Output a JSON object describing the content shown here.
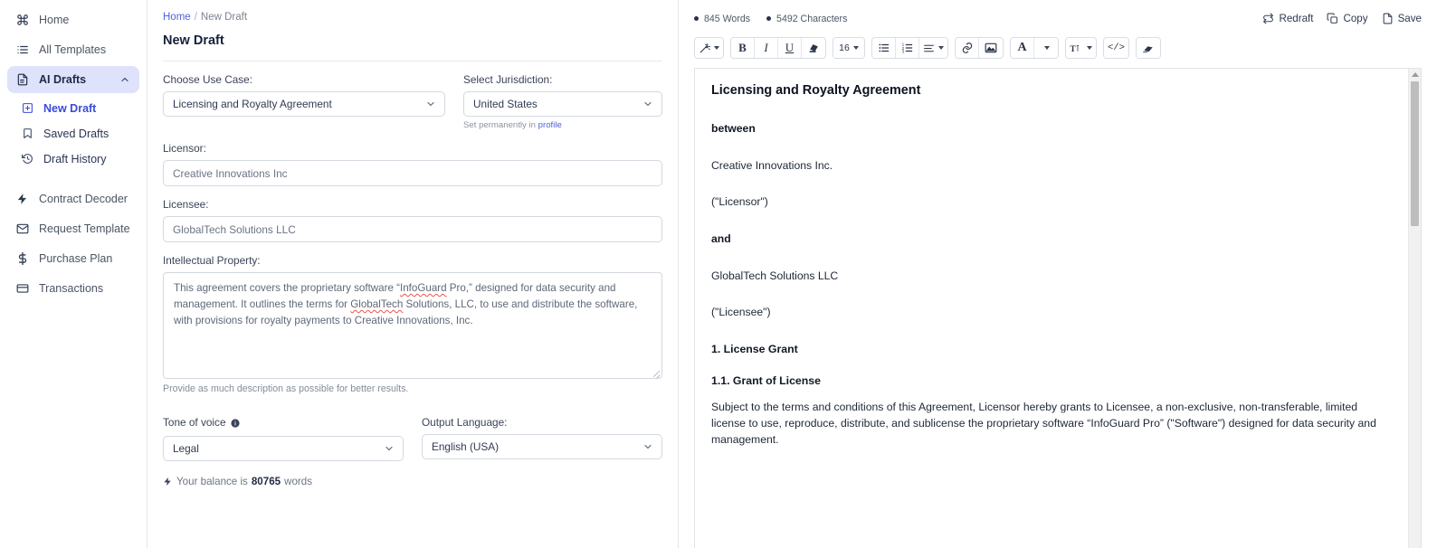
{
  "sidebar": {
    "items": [
      {
        "label": "Home",
        "icon": "command-icon"
      },
      {
        "label": "All Templates",
        "icon": "list-icon"
      },
      {
        "label": "AI Drafts",
        "icon": "document-icon",
        "chevron": "chevron-up-icon"
      }
    ],
    "sub_items": [
      {
        "label": "New Draft",
        "icon": "plus-square-icon"
      },
      {
        "label": "Saved Drafts",
        "icon": "bookmark-icon"
      },
      {
        "label": "Draft History",
        "icon": "history-icon"
      }
    ],
    "lower_items": [
      {
        "label": "Contract Decoder",
        "icon": "bolt-icon"
      },
      {
        "label": "Request Template",
        "icon": "envelope-icon"
      },
      {
        "label": "Purchase Plan",
        "icon": "dollar-icon"
      },
      {
        "label": "Transactions",
        "icon": "credit-card-icon"
      }
    ],
    "active_bg": "#dfe2fb",
    "accent": "#3a4bd8"
  },
  "breadcrumb": {
    "home": "Home",
    "separator": "/",
    "current": "New Draft"
  },
  "page_title": "New Draft",
  "form": {
    "use_case": {
      "label": "Choose Use Case:",
      "value": "Licensing and Royalty Agreement"
    },
    "jurisdiction": {
      "label": "Select Jurisdiction:",
      "value": "United States",
      "hint_prefix": "Set permanently in ",
      "hint_link": "profile"
    },
    "licensor": {
      "label": "Licensor:",
      "value": "Creative Innovations Inc",
      "placeholder": "Creative Innovations Inc"
    },
    "licensee": {
      "label": "Licensee:",
      "value": "GlobalTech Solutions LLC",
      "placeholder": "GlobalTech Solutions LLC"
    },
    "ip": {
      "label": "Intellectual Property:",
      "text_1": "This agreement covers the proprietary software “",
      "misspelled_1": "InfoGuard",
      "text_2": " Pro,” designed for data security and management. It outlines the terms for ",
      "misspelled_2": "GlobalTech",
      "text_3": " Solutions, LLC, to use and distribute the software, with provisions for royalty payments to Creative Innovations, Inc.",
      "helper": "Provide as much description as possible for better results."
    },
    "tone": {
      "label": "Tone of voice",
      "info_icon": "info-icon",
      "value": "Legal"
    },
    "output_language": {
      "label": "Output Language:",
      "value": "English (USA)"
    },
    "balance": {
      "prefix": "Your balance is",
      "amount": "80765",
      "suffix": "words",
      "icon": "bolt-icon"
    }
  },
  "editor": {
    "counts": [
      {
        "value": "845 Words"
      },
      {
        "value": "5492 Characters"
      }
    ],
    "actions": [
      {
        "label": "Redraft",
        "icon": "refresh-icon"
      },
      {
        "label": "Copy",
        "icon": "copy-icon"
      },
      {
        "label": "Save",
        "icon": "file-save-icon"
      }
    ],
    "toolbar": [
      {
        "group": 1,
        "buttons": [
          {
            "name": "magic-wand-icon",
            "label": "",
            "caret": true
          }
        ]
      },
      {
        "group": 2,
        "buttons": [
          {
            "name": "bold-button",
            "label": "B"
          },
          {
            "name": "italic-button",
            "label": "I"
          },
          {
            "name": "underline-button",
            "label": "U"
          },
          {
            "name": "highlight-icon",
            "label": ""
          }
        ]
      },
      {
        "group": 3,
        "buttons": [
          {
            "name": "font-size-select",
            "label": "16",
            "caret": true
          }
        ]
      },
      {
        "group": 4,
        "buttons": [
          {
            "name": "bullet-list-button",
            "label": ""
          },
          {
            "name": "numbered-list-button",
            "label": ""
          },
          {
            "name": "align-button",
            "label": "",
            "caret": true
          }
        ]
      },
      {
        "group": 5,
        "buttons": [
          {
            "name": "link-button",
            "label": ""
          },
          {
            "name": "image-button",
            "label": ""
          }
        ]
      },
      {
        "group": 6,
        "buttons": [
          {
            "name": "font-color-button",
            "label": "A"
          },
          {
            "name": "font-color-caret",
            "label": "",
            "caret": true
          }
        ]
      },
      {
        "group": 7,
        "buttons": [
          {
            "name": "text-style-button",
            "label": "T",
            "caret": true
          }
        ]
      },
      {
        "group": 8,
        "buttons": [
          {
            "name": "source-code-button",
            "label": "</>"
          }
        ]
      },
      {
        "group": 9,
        "buttons": [
          {
            "name": "clear-format-button",
            "label": ""
          }
        ]
      }
    ],
    "font_size": "16",
    "document": {
      "title": "Licensing and Royalty Agreement",
      "between": "between",
      "party_1": "Creative Innovations Inc.",
      "party_1_role": "(\"Licensor\")",
      "and": "and",
      "party_2": "GlobalTech Solutions LLC",
      "party_2_role": "(\"Licensee\")",
      "section_1": "1. License Grant",
      "section_1_1": "1.1. Grant of License",
      "section_1_1_body": "Subject to the terms and conditions of this Agreement, Licensor hereby grants to Licensee, a non-exclusive, non-transferable, limited license to use, reproduce, distribute, and sublicense the proprietary software “InfoGuard Pro” (\"Software\") designed for data security and management."
    }
  }
}
